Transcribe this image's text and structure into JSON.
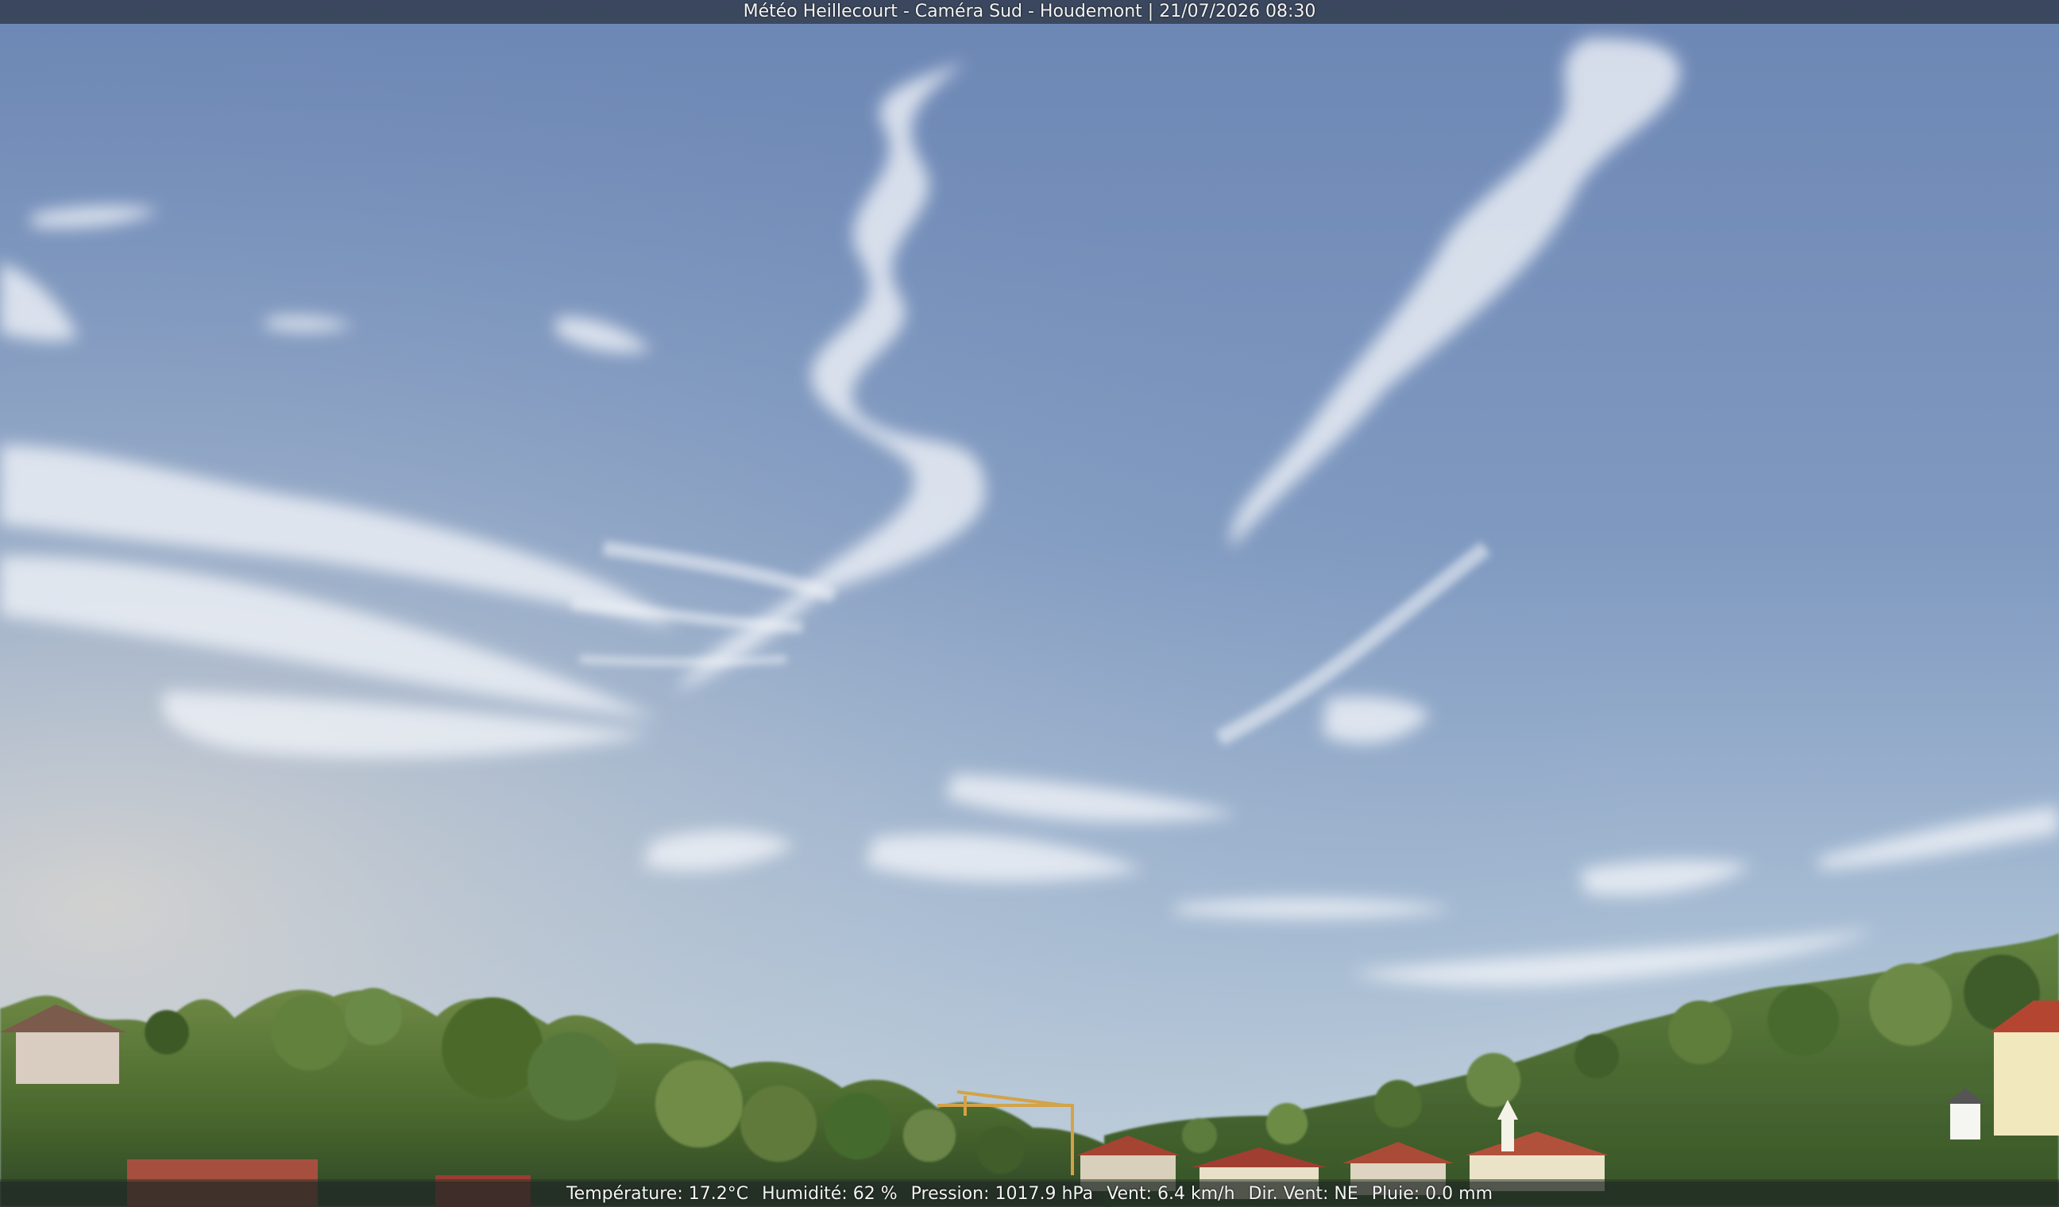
{
  "overlay": {
    "title": "Météo Heillecourt - Caméra Sud - Houdemont | 21/07/2026 08:30",
    "weather": {
      "temperature": "Température: 17.2°C",
      "humidity": "Humidité: 62 %",
      "pressure": "Pression: 1017.9 hPa",
      "wind": "Vent: 6.4 km/h",
      "wind_direction": "Dir. Vent: NE",
      "rain": "Pluie: 0.0 mm"
    }
  },
  "colors": {
    "sky_top": "#6f8db8",
    "sky_horizon": "#c8d5e0",
    "cloud": "#f2f4f8",
    "trees": "#4f6f32",
    "roofs": "#a54433",
    "walls": "#e8e0c7"
  },
  "scene": {
    "subject": "webcam-sky-panorama",
    "elements": [
      "cirrus-clouds",
      "trees",
      "red-roof-houses",
      "crane"
    ]
  }
}
